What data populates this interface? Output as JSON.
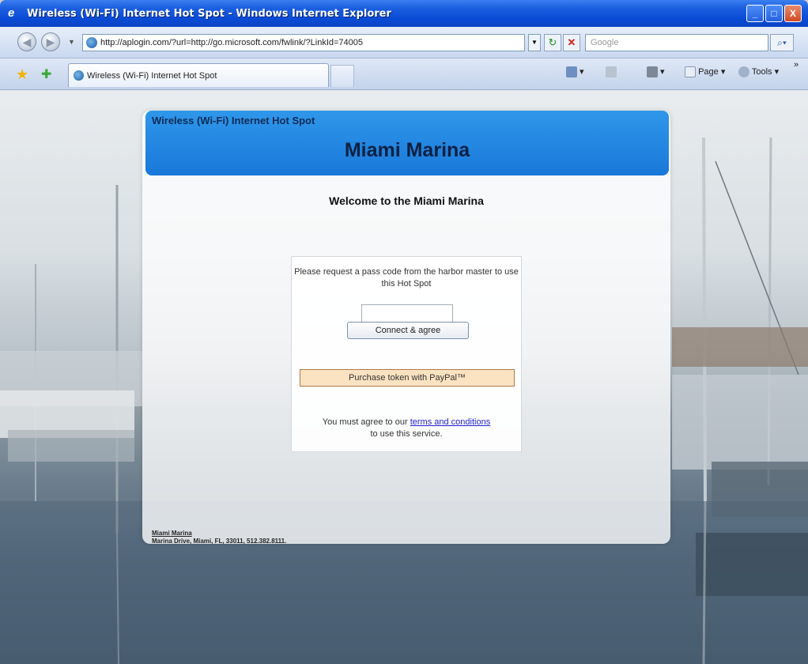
{
  "window": {
    "title": "Wireless (Wi-Fi) Internet Hot Spot - Windows Internet Explorer",
    "minimize": "_",
    "maximize": "□",
    "close": "X"
  },
  "address_bar": {
    "url": "http://aplogin.com/?url=http://go.microsoft.com/fwlink/?LinkId=74005",
    "search_placeholder": "Google"
  },
  "tab": {
    "label": "Wireless (Wi-Fi) Internet Hot Spot"
  },
  "commands": {
    "page": "Page",
    "tools": "Tools",
    "more": "»"
  },
  "page": {
    "subtitle": "Wireless (Wi-Fi) Internet Hot Spot",
    "title": "Miami Marina",
    "welcome": "Welcome to the Miami Marina",
    "instructions": "Please request a pass code from the harbor master to use this Hot Spot",
    "passcode_value": "",
    "connect_label": "Connect & agree",
    "paypal_label": "Purchase token with PayPal™",
    "terms_prefix": "You must agree to our",
    "terms_link": "terms and conditions",
    "terms_suffix": "to use this service.",
    "footer_name": "Miami Marina",
    "footer_address": "Marina Drive, Miami, FL, 33011, 512.382.8111."
  },
  "colors": {
    "header_blue": "#1978d9",
    "title_bar_blue": "#0a4bd6",
    "paypal_bg": "#fbe3c2"
  }
}
